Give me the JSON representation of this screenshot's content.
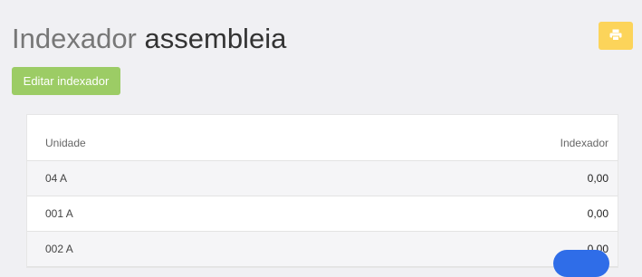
{
  "header": {
    "title_part1": "Indexador",
    "title_part2": "assembleia"
  },
  "toolbar": {
    "edit_label": "Editar indexador",
    "print_icon": "printer-icon"
  },
  "table": {
    "columns": [
      "Unidade",
      "Indexador"
    ],
    "rows": [
      {
        "unit": "04 A",
        "value": "0,00"
      },
      {
        "unit": "001 A",
        "value": "0,00"
      },
      {
        "unit": "002 A",
        "value": "0,00"
      }
    ]
  },
  "colors": {
    "edit_button": "#9ccc65",
    "print_button": "#fcd45a",
    "floating_button": "#2f6de8"
  }
}
